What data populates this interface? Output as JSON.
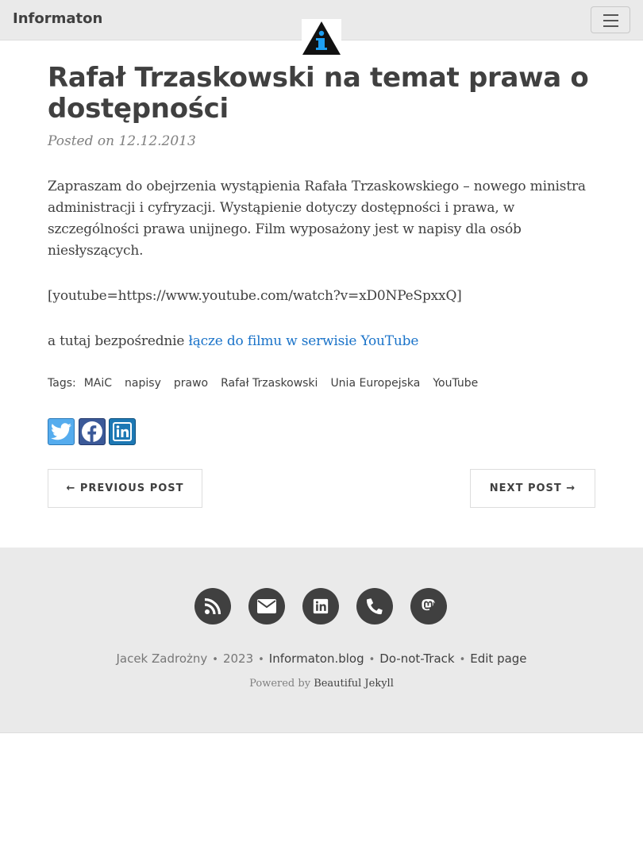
{
  "navbar": {
    "brand": "Informaton",
    "menu_icon": "hamburger-menu-icon",
    "avatar_icon": "information-triangle-logo"
  },
  "post": {
    "title": "Rafał Trzaskowski na temat prawa o dostępności",
    "meta": "Posted on 12.12.2013",
    "paragraph1": "Zapraszam do obejrzenia wystąpienia Rafała Trzaskowskiego – nowego ministra administracji i cyfryzacji. Wystąpienie dotyczy dostępności i prawa, w szczególności prawa unijnego. Film wyposażony jest w napisy dla osób niesłyszących.",
    "paragraph2": "[youtube=https://www.youtube.com/watch?v=xD0NPeSpxxQ]",
    "paragraph3_text": "a tutaj bezpośrednie",
    "paragraph3_link": "łącze do filmu w serwisie YouTube",
    "tags_label": "Tags:",
    "tags": [
      "MAiC",
      "napisy",
      "prawo",
      "Rafał Trzaskowski",
      "Unia Europejska",
      "YouTube"
    ]
  },
  "share": {
    "twitter_icon": "twitter-icon",
    "facebook_icon": "facebook-icon",
    "linkedin_icon": "linkedin-icon"
  },
  "pager": {
    "previous": "← PREVIOUS POST",
    "next": "NEXT POST →"
  },
  "footer": {
    "icons": [
      "rss-icon",
      "envelope-icon",
      "linkedin-icon",
      "phone-icon",
      "mastodon-icon"
    ],
    "author": "Jacek Zadrożny",
    "year": "2023",
    "site": "Informaton.blog",
    "dnt": "Do-not-Track",
    "edit": "Edit page",
    "powered_prefix": "Powered by",
    "powered_link": "Beautiful Jekyll"
  },
  "colors": {
    "navbar_bg": "#eaeaea",
    "text": "#404040",
    "link": "#1a73c9",
    "twitter": "#55acee",
    "facebook": "#3b5998",
    "linkedin": "#1d78b4"
  }
}
